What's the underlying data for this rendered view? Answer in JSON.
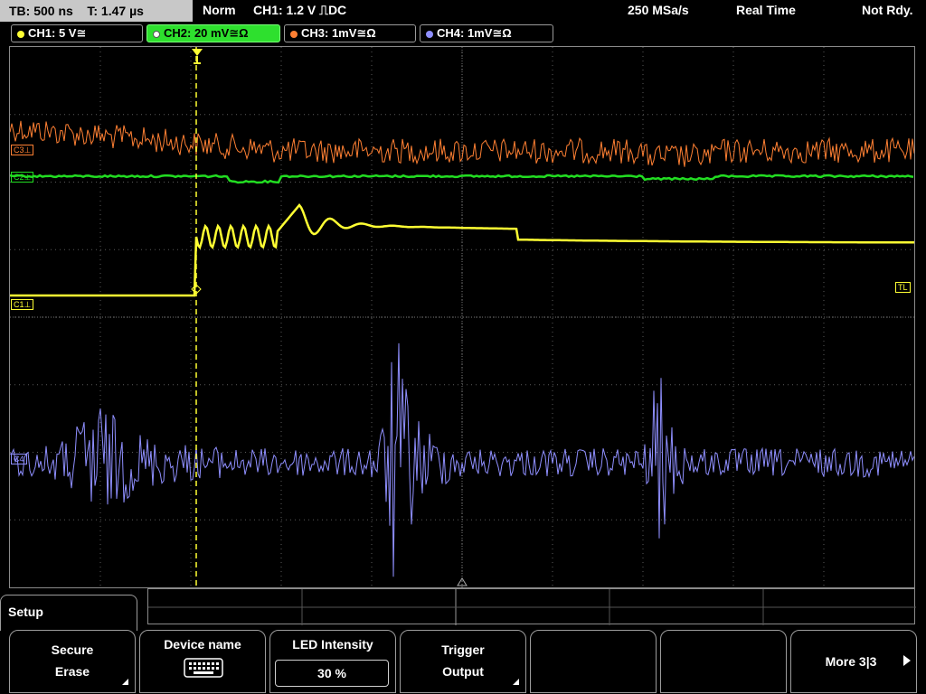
{
  "header": {
    "timebase": "TB: 500 ns",
    "trigger_time": "T: 1.47 µs",
    "mode": "Norm",
    "trigger_setting": "CH1: 1.2 V ⎍DC",
    "sample_rate": "250 MSa/s",
    "acq_mode": "Real Time",
    "status": "Not Rdy."
  },
  "channels": [
    {
      "label": "CH1: 5 V≅",
      "color": "#ffff33",
      "active": false
    },
    {
      "label": "CH2: 20 mV≅Ω",
      "color": "#22dd22",
      "active": true
    },
    {
      "label": "CH3: 1mV≅Ω",
      "color": "#ff8033",
      "active": false
    },
    {
      "label": "CH4: 1mV≅Ω",
      "color": "#8f8fff",
      "active": false
    }
  ],
  "markers": {
    "c3": "C3⊥",
    "c2": "C2⊥",
    "c1": "C1⊥",
    "c4": "C4",
    "trigger_level": "TL",
    "trigger_pos": "T"
  },
  "menu": {
    "title": "Setup",
    "buttons": [
      {
        "line1": "Secure",
        "line2": "Erase",
        "corner": true
      },
      {
        "line1": "Device name",
        "line2": "",
        "corner": false,
        "icon": "keyboard-icon"
      },
      {
        "line1": "LED Intensity",
        "line2": "30 %",
        "corner": false
      },
      {
        "line1": "Trigger",
        "line2": "Output",
        "corner": true
      },
      {
        "line1": "",
        "line2": "",
        "corner": false
      },
      {
        "line1": "",
        "line2": "",
        "corner": false
      },
      {
        "line1": "More 3|3",
        "line2": "",
        "corner": false
      }
    ]
  },
  "colors": {
    "ch1": "#ffff33",
    "ch2": "#22dd22",
    "ch3": "#ff8033",
    "ch4": "#8f8fff",
    "grid": "#5a5a5a"
  }
}
